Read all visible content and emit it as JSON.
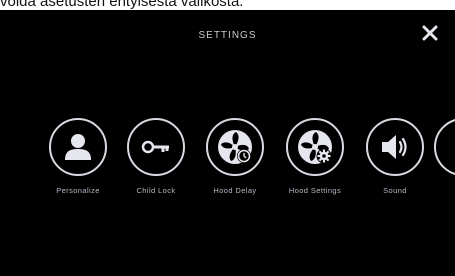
{
  "caption": "voida asetusten erityisestä valikosta.",
  "header": {
    "title": "SETTINGS",
    "close_icon": "close-icon"
  },
  "menu": {
    "items": [
      {
        "label": "Personalize",
        "icon": "person-icon"
      },
      {
        "label": "Child Lock",
        "icon": "key-icon"
      },
      {
        "label": "Hood Delay",
        "icon": "fan-clock-icon"
      },
      {
        "label": "Hood Settings",
        "icon": "fan-gear-icon"
      },
      {
        "label": "Sound",
        "icon": "speaker-icon"
      }
    ]
  },
  "colors": {
    "background": "#000000",
    "ring": "#d9d9e2",
    "text": "#b8b8c6"
  }
}
